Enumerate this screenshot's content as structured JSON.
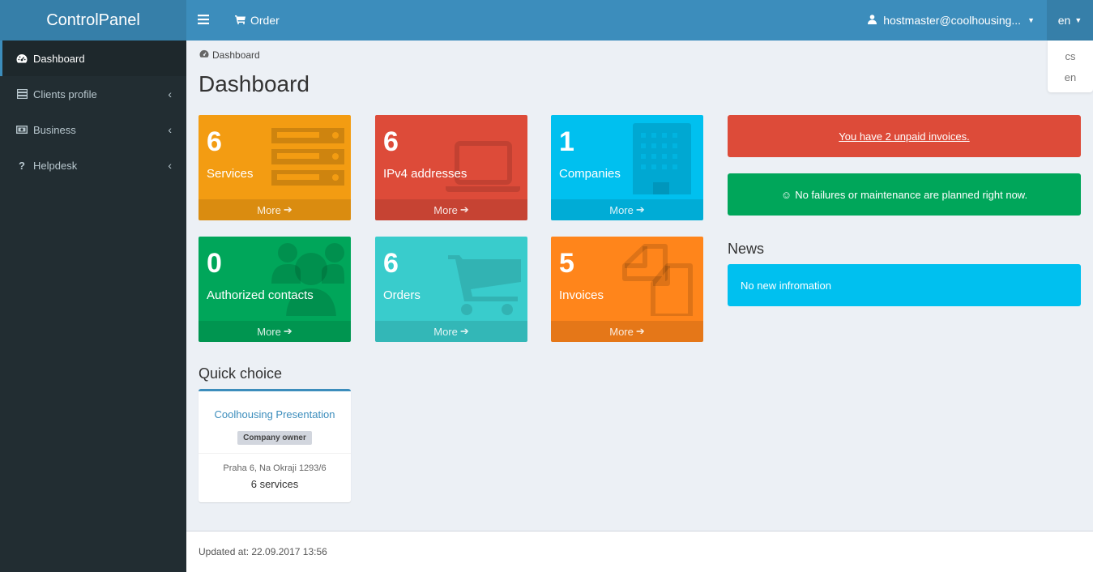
{
  "app": {
    "title": "ControlPanel"
  },
  "sidebar": {
    "items": [
      {
        "label": "Dashboard",
        "icon": "dashboard-icon",
        "active": true
      },
      {
        "label": "Clients profile",
        "icon": "server-list-icon"
      },
      {
        "label": "Business",
        "icon": "money-icon"
      },
      {
        "label": "Helpdesk",
        "icon": "question-icon"
      }
    ]
  },
  "topbar": {
    "menu_icon": "hamburger-icon",
    "order_label": "Order",
    "user_label": "hostmaster@coolhousing...",
    "lang_label": "en",
    "lang_options": [
      "cs",
      "en"
    ]
  },
  "breadcrumb": {
    "label": "Dashboard"
  },
  "page": {
    "title": "Dashboard"
  },
  "tiles": [
    {
      "value": "6",
      "label": "Services",
      "more": "More",
      "color": "#f39c12",
      "icon": "server-icon"
    },
    {
      "value": "6",
      "label": "IPv4 addresses",
      "more": "More",
      "color": "#dd4b39",
      "icon": "laptop-icon"
    },
    {
      "value": "1",
      "label": "Companies",
      "more": "More",
      "color": "#00c0ef",
      "icon": "building-icon"
    },
    {
      "value": "0",
      "label": "Authorized contacts",
      "more": "More",
      "color": "#00a65a",
      "icon": "users-icon"
    },
    {
      "value": "6",
      "label": "Orders",
      "more": "More",
      "color": "#39cccc",
      "icon": "cart-icon"
    },
    {
      "value": "5",
      "label": "Invoices",
      "more": "More",
      "color": "#ff851b",
      "icon": "copy-icon"
    }
  ],
  "alerts": {
    "unpaid": {
      "text": "You have 2 unpaid invoices.",
      "color": "#dd4b39"
    },
    "status": {
      "text": "No failures or maintenance are planned right now.",
      "color": "#00a65a"
    }
  },
  "news": {
    "title": "News",
    "message": "No new infromation",
    "color": "#00c0ef"
  },
  "quick_choice": {
    "title": "Quick choice",
    "company": "Coolhousing Presentation",
    "role": "Company owner",
    "address": "Praha 6, Na Okraji 1293/6",
    "services": "6 services"
  },
  "footer": {
    "updated": "Updated at: 22.09.2017 13:56"
  }
}
